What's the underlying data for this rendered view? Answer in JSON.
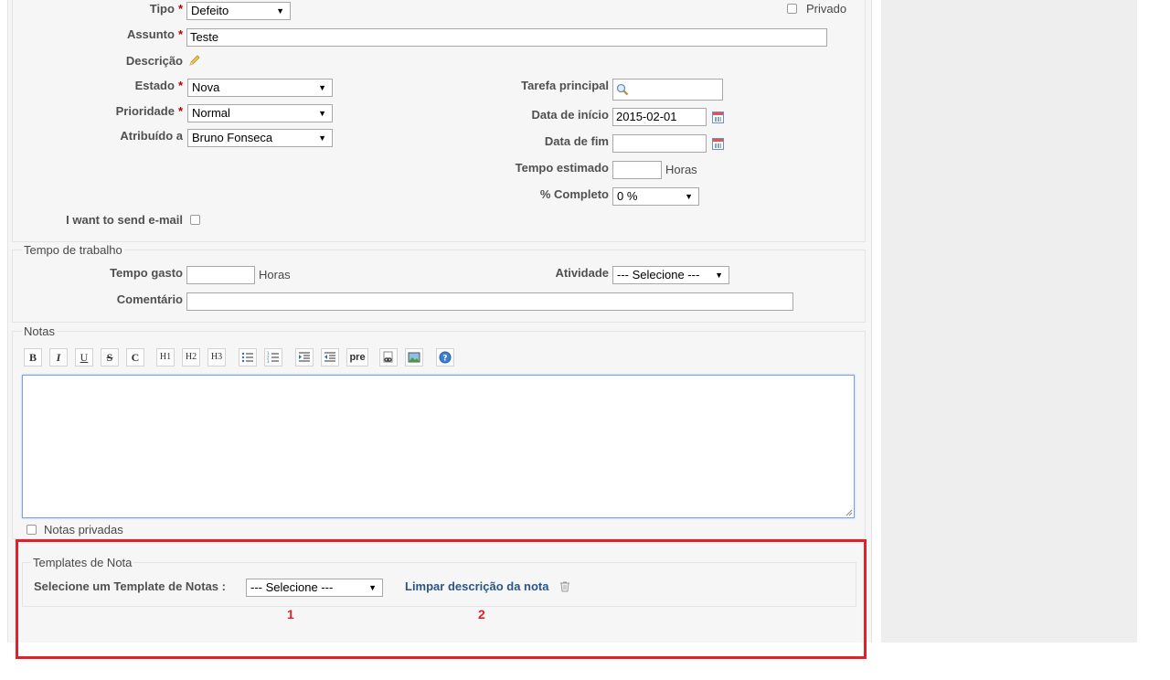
{
  "form": {
    "tipo": {
      "label": "Tipo",
      "value": "Defeito"
    },
    "privado": {
      "label": "Privado"
    },
    "assunto": {
      "label": "Assunto",
      "value": "Teste"
    },
    "descricao": {
      "label": "Descrição"
    },
    "estado": {
      "label": "Estado",
      "value": "Nova"
    },
    "prioridade": {
      "label": "Prioridade",
      "value": "Normal"
    },
    "atribuido": {
      "label": "Atribuído a",
      "value": "Bruno Fonseca"
    },
    "tarefa_principal": {
      "label": "Tarefa principal",
      "value": ""
    },
    "data_inicio": {
      "label": "Data de início",
      "value": "2015-02-01"
    },
    "data_fim": {
      "label": "Data de fim",
      "value": ""
    },
    "tempo_estimado": {
      "label": "Tempo estimado",
      "unit": "Horas"
    },
    "completo": {
      "label": "% Completo",
      "value": "0 %"
    },
    "send_email": {
      "label": "I want to send e-mail"
    },
    "required_marker": "*"
  },
  "tempo_trabalho": {
    "legend": "Tempo de trabalho",
    "tempo_gasto": {
      "label": "Tempo gasto",
      "unit": "Horas"
    },
    "atividade": {
      "label": "Atividade",
      "value": "--- Selecione ---"
    },
    "comentario": {
      "label": "Comentário"
    }
  },
  "notas": {
    "legend": "Notas",
    "toolbar": [
      "B",
      "I",
      "U",
      "S",
      "C",
      "H1",
      "H2",
      "H3",
      "pre"
    ],
    "notas_privadas": "Notas privadas"
  },
  "templates": {
    "legend": "Templates de Nota",
    "select_label": "Selecione um Template de Notas :",
    "select_value": "--- Selecione ---",
    "clear_link": "Limpar descrição da nota",
    "markers": [
      "1",
      "2"
    ]
  },
  "colors": {
    "highlight": "#e0202a",
    "link": "#2a5685",
    "required": "#bb0000"
  }
}
